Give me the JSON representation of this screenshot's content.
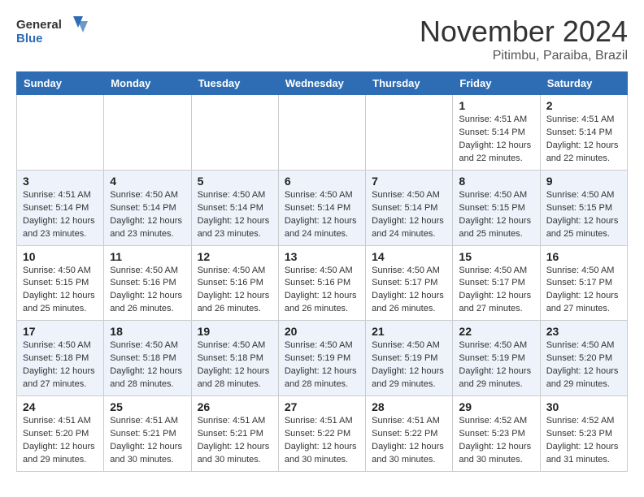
{
  "header": {
    "logo_line1": "General",
    "logo_line2": "Blue",
    "month": "November 2024",
    "location": "Pitimbu, Paraiba, Brazil"
  },
  "weekdays": [
    "Sunday",
    "Monday",
    "Tuesday",
    "Wednesday",
    "Thursday",
    "Friday",
    "Saturday"
  ],
  "weeks": [
    [
      {
        "day": "",
        "info": ""
      },
      {
        "day": "",
        "info": ""
      },
      {
        "day": "",
        "info": ""
      },
      {
        "day": "",
        "info": ""
      },
      {
        "day": "",
        "info": ""
      },
      {
        "day": "1",
        "info": "Sunrise: 4:51 AM\nSunset: 5:14 PM\nDaylight: 12 hours\nand 22 minutes."
      },
      {
        "day": "2",
        "info": "Sunrise: 4:51 AM\nSunset: 5:14 PM\nDaylight: 12 hours\nand 22 minutes."
      }
    ],
    [
      {
        "day": "3",
        "info": "Sunrise: 4:51 AM\nSunset: 5:14 PM\nDaylight: 12 hours\nand 23 minutes."
      },
      {
        "day": "4",
        "info": "Sunrise: 4:50 AM\nSunset: 5:14 PM\nDaylight: 12 hours\nand 23 minutes."
      },
      {
        "day": "5",
        "info": "Sunrise: 4:50 AM\nSunset: 5:14 PM\nDaylight: 12 hours\nand 23 minutes."
      },
      {
        "day": "6",
        "info": "Sunrise: 4:50 AM\nSunset: 5:14 PM\nDaylight: 12 hours\nand 24 minutes."
      },
      {
        "day": "7",
        "info": "Sunrise: 4:50 AM\nSunset: 5:14 PM\nDaylight: 12 hours\nand 24 minutes."
      },
      {
        "day": "8",
        "info": "Sunrise: 4:50 AM\nSunset: 5:15 PM\nDaylight: 12 hours\nand 25 minutes."
      },
      {
        "day": "9",
        "info": "Sunrise: 4:50 AM\nSunset: 5:15 PM\nDaylight: 12 hours\nand 25 minutes."
      }
    ],
    [
      {
        "day": "10",
        "info": "Sunrise: 4:50 AM\nSunset: 5:15 PM\nDaylight: 12 hours\nand 25 minutes."
      },
      {
        "day": "11",
        "info": "Sunrise: 4:50 AM\nSunset: 5:16 PM\nDaylight: 12 hours\nand 26 minutes."
      },
      {
        "day": "12",
        "info": "Sunrise: 4:50 AM\nSunset: 5:16 PM\nDaylight: 12 hours\nand 26 minutes."
      },
      {
        "day": "13",
        "info": "Sunrise: 4:50 AM\nSunset: 5:16 PM\nDaylight: 12 hours\nand 26 minutes."
      },
      {
        "day": "14",
        "info": "Sunrise: 4:50 AM\nSunset: 5:17 PM\nDaylight: 12 hours\nand 26 minutes."
      },
      {
        "day": "15",
        "info": "Sunrise: 4:50 AM\nSunset: 5:17 PM\nDaylight: 12 hours\nand 27 minutes."
      },
      {
        "day": "16",
        "info": "Sunrise: 4:50 AM\nSunset: 5:17 PM\nDaylight: 12 hours\nand 27 minutes."
      }
    ],
    [
      {
        "day": "17",
        "info": "Sunrise: 4:50 AM\nSunset: 5:18 PM\nDaylight: 12 hours\nand 27 minutes."
      },
      {
        "day": "18",
        "info": "Sunrise: 4:50 AM\nSunset: 5:18 PM\nDaylight: 12 hours\nand 28 minutes."
      },
      {
        "day": "19",
        "info": "Sunrise: 4:50 AM\nSunset: 5:18 PM\nDaylight: 12 hours\nand 28 minutes."
      },
      {
        "day": "20",
        "info": "Sunrise: 4:50 AM\nSunset: 5:19 PM\nDaylight: 12 hours\nand 28 minutes."
      },
      {
        "day": "21",
        "info": "Sunrise: 4:50 AM\nSunset: 5:19 PM\nDaylight: 12 hours\nand 29 minutes."
      },
      {
        "day": "22",
        "info": "Sunrise: 4:50 AM\nSunset: 5:19 PM\nDaylight: 12 hours\nand 29 minutes."
      },
      {
        "day": "23",
        "info": "Sunrise: 4:50 AM\nSunset: 5:20 PM\nDaylight: 12 hours\nand 29 minutes."
      }
    ],
    [
      {
        "day": "24",
        "info": "Sunrise: 4:51 AM\nSunset: 5:20 PM\nDaylight: 12 hours\nand 29 minutes."
      },
      {
        "day": "25",
        "info": "Sunrise: 4:51 AM\nSunset: 5:21 PM\nDaylight: 12 hours\nand 30 minutes."
      },
      {
        "day": "26",
        "info": "Sunrise: 4:51 AM\nSunset: 5:21 PM\nDaylight: 12 hours\nand 30 minutes."
      },
      {
        "day": "27",
        "info": "Sunrise: 4:51 AM\nSunset: 5:22 PM\nDaylight: 12 hours\nand 30 minutes."
      },
      {
        "day": "28",
        "info": "Sunrise: 4:51 AM\nSunset: 5:22 PM\nDaylight: 12 hours\nand 30 minutes."
      },
      {
        "day": "29",
        "info": "Sunrise: 4:52 AM\nSunset: 5:23 PM\nDaylight: 12 hours\nand 30 minutes."
      },
      {
        "day": "30",
        "info": "Sunrise: 4:52 AM\nSunset: 5:23 PM\nDaylight: 12 hours\nand 31 minutes."
      }
    ]
  ]
}
